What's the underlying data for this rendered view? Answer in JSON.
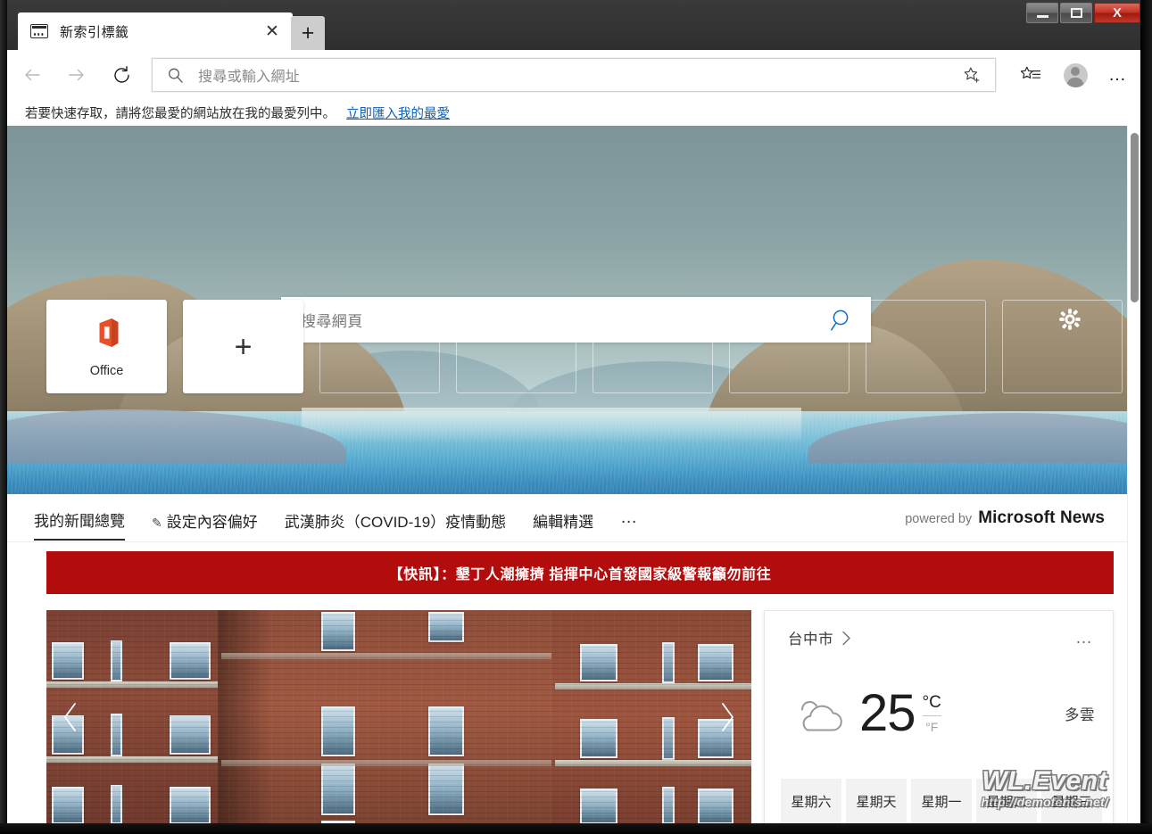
{
  "window": {
    "controls": {
      "minimize_label": "Minimize",
      "maximize_label": "Maximize",
      "close_label": "X"
    }
  },
  "tabstrip": {
    "active_tab": {
      "title": "新索引標籤",
      "favicon": "new-tab-icon",
      "close_label": "✕"
    },
    "new_tab_label": "+"
  },
  "toolbar": {
    "back_icon": "back-arrow-icon",
    "forward_icon": "forward-arrow-icon",
    "refresh_icon": "refresh-icon",
    "address": {
      "placeholder": "搜尋或輸入網址",
      "value": "",
      "search_icon": "search-icon"
    },
    "add_favorite_icon": "star-plus-icon",
    "hub_icon": "favorites-hub-icon",
    "profile_icon": "profile-avatar-icon",
    "more_label": "…"
  },
  "favorites_bar": {
    "message": "若要快速存取，請將您最愛的網站放在我的最愛列中。",
    "import_link": "立即匯入我的最愛"
  },
  "hero": {
    "search": {
      "placeholder": "搜尋網頁",
      "value": "",
      "icon": "search-icon"
    },
    "settings_icon": "gear-icon",
    "tiles": [
      {
        "label": "Office",
        "type": "filled",
        "icon": "office-logo-icon"
      },
      {
        "label": "+",
        "type": "add"
      },
      {
        "label": "",
        "type": "empty"
      },
      {
        "label": "",
        "type": "empty"
      },
      {
        "label": "",
        "type": "empty"
      },
      {
        "label": "",
        "type": "empty"
      },
      {
        "label": "",
        "type": "empty"
      },
      {
        "label": "",
        "type": "empty"
      }
    ]
  },
  "news": {
    "tabs": [
      {
        "label": "我的新聞總覽",
        "active": true,
        "icon": ""
      },
      {
        "label": "設定內容偏好",
        "active": false,
        "icon": "pencil-icon"
      },
      {
        "label": "武漢肺炎（COVID-19）疫情動態",
        "active": false,
        "icon": ""
      },
      {
        "label": "編輯精選",
        "active": false,
        "icon": ""
      }
    ],
    "more_label": "…",
    "powered_by_prefix": "powered by",
    "powered_by_brand": "Microsoft News",
    "breaking_banner": "【快訊】：墾丁人潮擁擠 指揮中心首發國家級警報籲勿前往",
    "carousel": {
      "prev_label": "‹",
      "next_label": "›"
    }
  },
  "weather": {
    "city": "台中市",
    "city_chevron_icon": "chevron-right-icon",
    "more_label": "…",
    "condition_icon": "cloudy-icon",
    "temperature": "25",
    "unit_celsius": "°C",
    "unit_fahrenheit": "°F",
    "condition": "多雲",
    "days": [
      "星期六",
      "星期天",
      "星期一",
      "星期二",
      "星期三"
    ]
  },
  "scrollbar": {
    "orientation": "vertical"
  },
  "watermark": {
    "title": "WL.Event",
    "url": "http://demofents.net/"
  },
  "colors": {
    "accent_blue": "#0f5fb5",
    "breaking_red": "#b30c0c",
    "office_orange": "#e8502a",
    "close_button_red": "#c63124"
  }
}
